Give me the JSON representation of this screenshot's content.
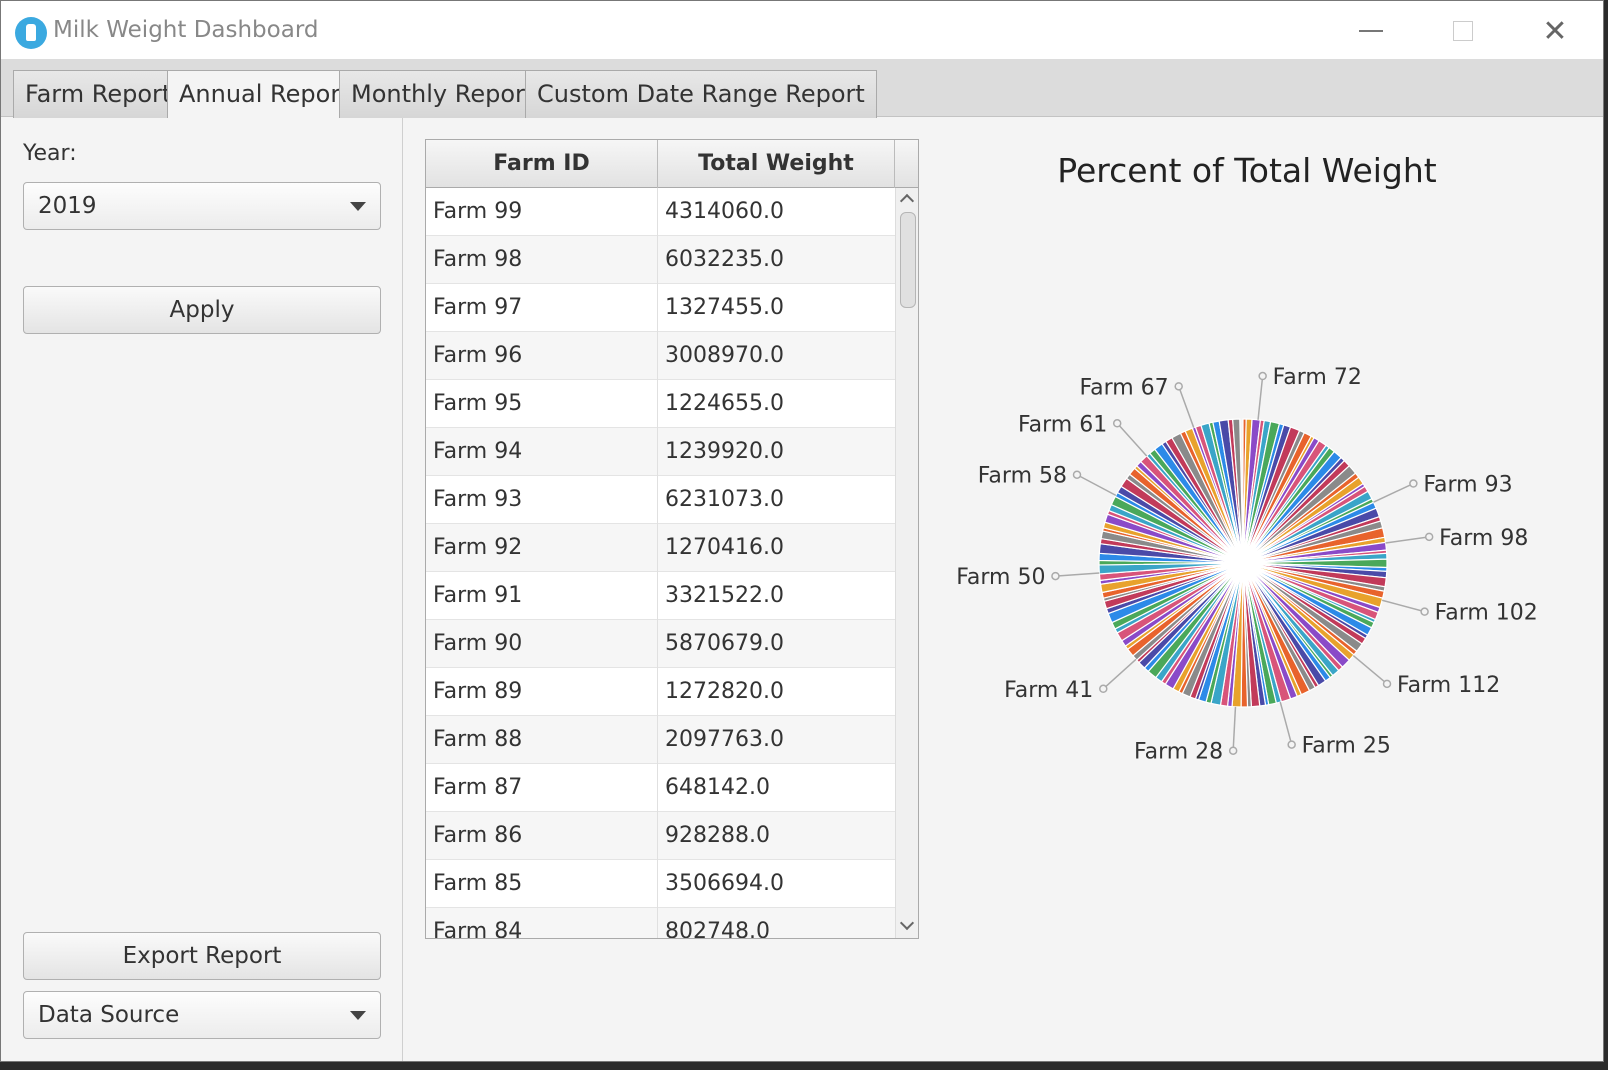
{
  "window": {
    "title": "Milk Weight Dashboard"
  },
  "tabs": [
    {
      "label": "Farm Report",
      "active": false
    },
    {
      "label": "Annual Report",
      "active": true
    },
    {
      "label": "Monthly Report",
      "active": false
    },
    {
      "label": "Custom Date Range Report",
      "active": false
    }
  ],
  "left_panel": {
    "year_label": "Year:",
    "year_value": "2019",
    "apply_label": "Apply",
    "export_label": "Export Report",
    "data_source_label": "Data Source"
  },
  "table": {
    "columns": [
      "Farm ID",
      "Total Weight"
    ],
    "rows": [
      [
        "Farm 99",
        "4314060.0"
      ],
      [
        "Farm 98",
        "6032235.0"
      ],
      [
        "Farm 97",
        "1327455.0"
      ],
      [
        "Farm 96",
        "3008970.0"
      ],
      [
        "Farm 95",
        "1224655.0"
      ],
      [
        "Farm 94",
        "1239920.0"
      ],
      [
        "Farm 93",
        "6231073.0"
      ],
      [
        "Farm 92",
        "1270416.0"
      ],
      [
        "Farm 91",
        "3321522.0"
      ],
      [
        "Farm 90",
        "5870679.0"
      ],
      [
        "Farm 89",
        "1272820.0"
      ],
      [
        "Farm 88",
        "2097763.0"
      ],
      [
        "Farm 87",
        "648142.0"
      ],
      [
        "Farm 86",
        "928288.0"
      ],
      [
        "Farm 85",
        "3506694.0"
      ],
      [
        "Farm 84",
        "802748.0"
      ]
    ]
  },
  "chart_data": {
    "type": "pie",
    "title": "Percent of Total Weight",
    "visible_labels": [
      "Farm 72",
      "Farm 93",
      "Farm 98",
      "Farm 102",
      "Farm 112",
      "Farm 25",
      "Farm 28",
      "Farm 41",
      "Farm 50",
      "Farm 58",
      "Farm 61",
      "Farm 67"
    ],
    "palette": [
      "#e8632c",
      "#4a4aa8",
      "#3aa5c8",
      "#e8a22c",
      "#c23a5a",
      "#4aa85a",
      "#8a4ac8",
      "#8a8a8a",
      "#2c8ae8",
      "#d8547a"
    ]
  }
}
